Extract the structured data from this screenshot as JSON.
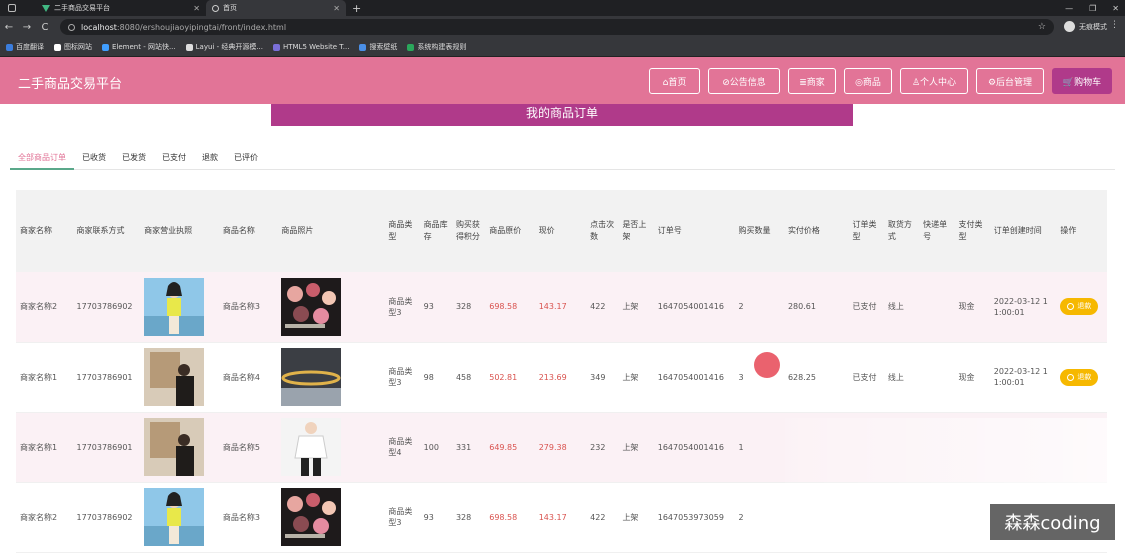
{
  "browser": {
    "tabs": [
      {
        "label": "二手商品交易平台",
        "active": false
      },
      {
        "label": "首页",
        "active": true
      }
    ],
    "url_host": "localhost",
    "url_rest": ":8080/ershoujiaoyipingtai/front/index.html",
    "profile_label": "无痕模式",
    "bookmarks": [
      "百度翻译",
      "图标网站",
      "Element - 网站快...",
      "Layui - 经典开源模...",
      "HTML5 Website T...",
      "搜索壁纸",
      "系统构建表规则"
    ]
  },
  "header": {
    "title": "二手商品交易平台",
    "nav": [
      "⌂首页",
      "⊘公告信息",
      "≣商家",
      "◎商品",
      "♙个人中心",
      "⚙后台管理",
      "🛒购物车"
    ]
  },
  "banner": "我的商品订单",
  "status_tabs": [
    "全部商品订单",
    "已收货",
    "已发货",
    "已支付",
    "退款",
    "已评价"
  ],
  "table": {
    "headers": [
      "商家名称",
      "商家联系方式",
      "商家营业执照",
      "商品名称",
      "商品照片",
      "商品类型",
      "商品库存",
      "购买获得积分",
      "商品原价",
      "现价",
      "点击次数",
      "是否上架",
      "订单号",
      "购买数量",
      "实付价格",
      "订单类型",
      "取货方式",
      "快递单号",
      "支付类型",
      "订单创建时间",
      "操作"
    ],
    "rows": [
      {
        "merchant": "商家名称2",
        "phone": "17703786902",
        "license": "woman-yellow",
        "goods": "商品名称3",
        "photo": "palette",
        "type": "商品类型3",
        "stock": "93",
        "points": "328",
        "orig": "698.58",
        "price": "143.17",
        "clicks": "422",
        "onshelf": "上架",
        "order": "1647054001416",
        "qty": "2",
        "paid": "280.61",
        "otype": "已支付",
        "pickup": "线上",
        "express": "",
        "paytype": "现金",
        "created": "2022-03-12 11:00:01",
        "action": "退款"
      },
      {
        "merchant": "商家名称1",
        "phone": "17703786901",
        "license": "man-painting",
        "goods": "商品名称4",
        "photo": "bracelet",
        "type": "商品类型3",
        "stock": "98",
        "points": "458",
        "orig": "502.81",
        "price": "213.69",
        "clicks": "349",
        "onshelf": "上架",
        "order": "1647054001416",
        "qty": "3",
        "paid": "628.25",
        "otype": "已支付",
        "pickup": "线上",
        "express": "",
        "paytype": "现金",
        "created": "2022-03-12 11:00:01",
        "action": "退款"
      },
      {
        "merchant": "商家名称1",
        "phone": "17703786901",
        "license": "man-painting",
        "goods": "商品名称5",
        "photo": "shirt",
        "type": "商品类型4",
        "stock": "100",
        "points": "331",
        "orig": "649.85",
        "price": "279.38",
        "clicks": "232",
        "onshelf": "上架",
        "order": "1647054001416",
        "qty": "1",
        "paid": "",
        "otype": "",
        "pickup": "",
        "express": "",
        "paytype": "",
        "created": "",
        "action": ""
      },
      {
        "merchant": "商家名称2",
        "phone": "17703786902",
        "license": "woman-yellow",
        "goods": "商品名称3",
        "photo": "palette",
        "type": "商品类型3",
        "stock": "93",
        "points": "328",
        "orig": "698.58",
        "price": "143.17",
        "clicks": "422",
        "onshelf": "上架",
        "order": "1647053973059",
        "qty": "2",
        "paid": "",
        "otype": "",
        "pickup": "",
        "express": "",
        "paytype": "",
        "created": "",
        "action": ""
      }
    ]
  },
  "watermark": "森森coding",
  "colors": {
    "header": "#e27497",
    "banner": "#b03a8a",
    "price_red": "#d9534f",
    "action_btn": "#f6b800"
  }
}
